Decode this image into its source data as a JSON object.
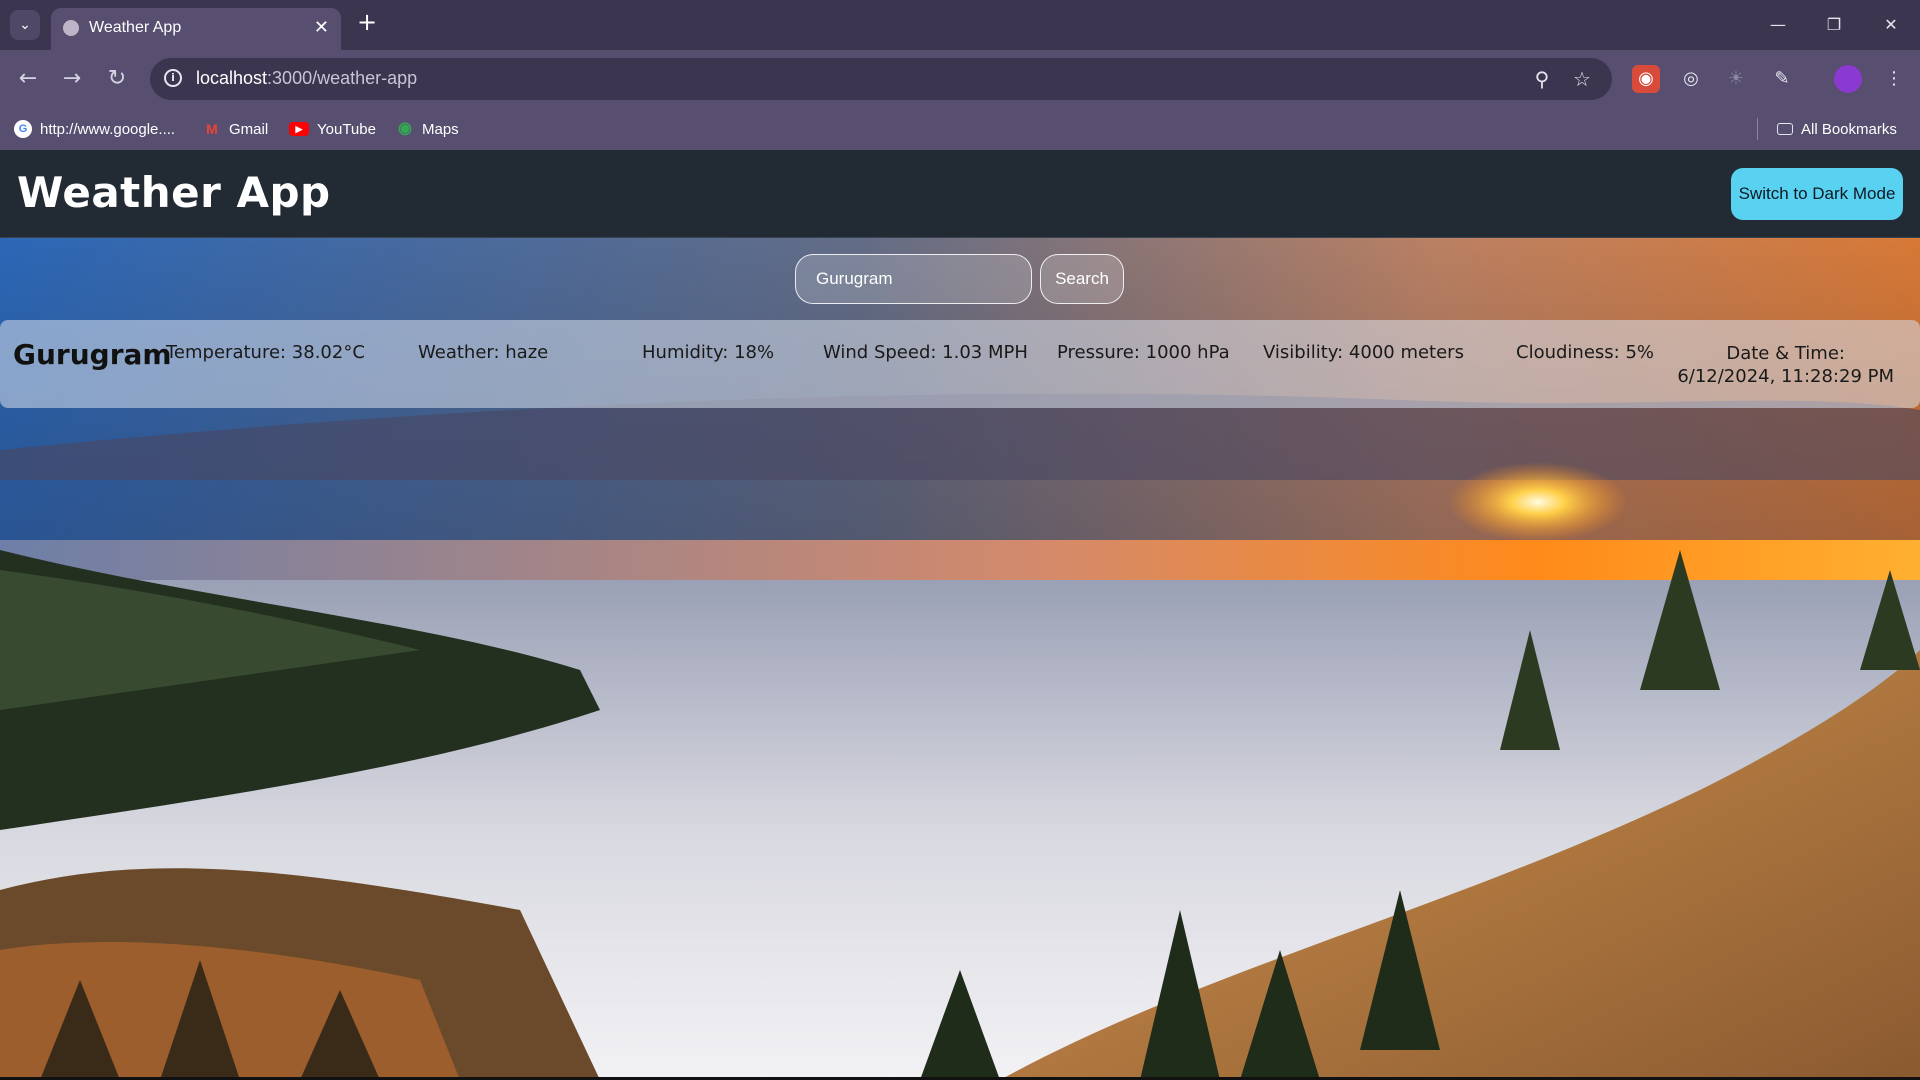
{
  "browser": {
    "tab_title": "Weather App",
    "url_host": "localhost",
    "url_path": ":3000/weather-app",
    "bookmarks": [
      {
        "label": "http://www.google...."
      },
      {
        "label": "Gmail"
      },
      {
        "label": "YouTube"
      },
      {
        "label": "Maps"
      }
    ],
    "all_bookmarks": "All Bookmarks"
  },
  "app": {
    "title": "Weather App",
    "dark_mode_button": "Switch to Dark Mode",
    "search": {
      "value": "Gurugram",
      "button": "Search"
    }
  },
  "weather": {
    "city": "Gurugram",
    "temperature": "Temperature: 38.02°C",
    "condition": "Weather: haze",
    "humidity": "Humidity: 18%",
    "wind": "Wind Speed: 1.03 MPH",
    "pressure": "Pressure: 1000 hPa",
    "visibility": "Visibility: 4000 meters",
    "cloudiness": "Cloudiness: 5%",
    "datetime_label": "Date & Time:",
    "datetime_value": "6/12/2024, 11:28:29 PM"
  },
  "colors": {
    "chrome_dark": "#3b3550",
    "chrome_light": "#574e70",
    "header_bg": "#222a33",
    "accent_button": "#59d2f2"
  }
}
